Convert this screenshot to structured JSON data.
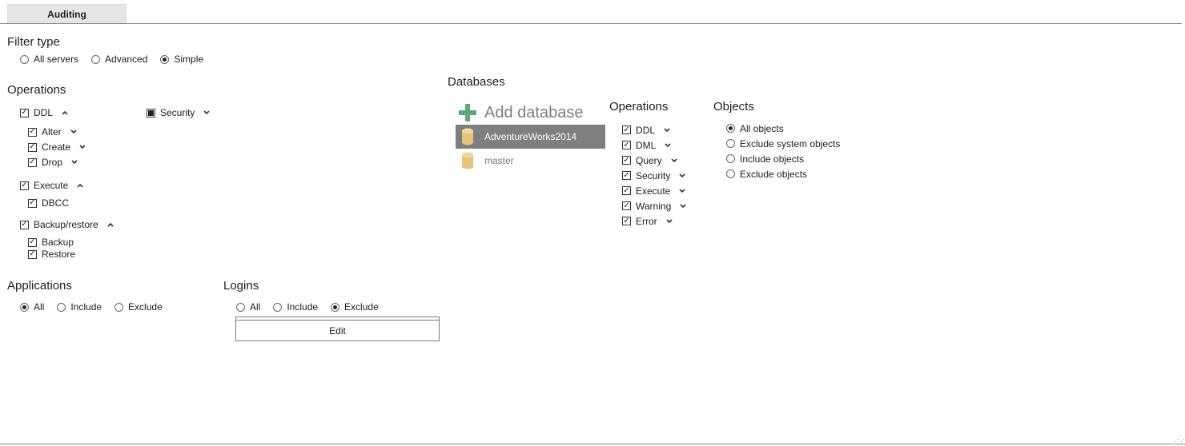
{
  "tab": {
    "label": "Auditing"
  },
  "filter_type": {
    "title": "Filter type",
    "options": [
      {
        "label": "All servers",
        "selected": false
      },
      {
        "label": "Advanced",
        "selected": false
      },
      {
        "label": "Simple",
        "selected": true
      }
    ]
  },
  "operations": {
    "title": "Operations",
    "ddl": {
      "label": "DDL",
      "checked": true,
      "children": [
        "Alter",
        "Create",
        "Drop"
      ]
    },
    "security": {
      "label": "Security",
      "state": "partial"
    },
    "execute": {
      "label": "Execute",
      "checked": true,
      "children": [
        "DBCC"
      ]
    },
    "backup_restore": {
      "label": "Backup/restore",
      "checked": true,
      "children": [
        "Backup",
        "Restore"
      ]
    }
  },
  "applications": {
    "title": "Applications",
    "options": [
      {
        "label": "All",
        "selected": true
      },
      {
        "label": "Include",
        "selected": false
      },
      {
        "label": "Exclude",
        "selected": false
      }
    ]
  },
  "logins": {
    "title": "Logins",
    "options": [
      {
        "label": "All",
        "selected": false
      },
      {
        "label": "Include",
        "selected": false
      },
      {
        "label": "Exclude",
        "selected": true
      }
    ],
    "edit_label": "Edit"
  },
  "databases": {
    "title": "Databases",
    "add_label": "Add database",
    "items": [
      {
        "name": "AdventureWorks2014",
        "selected": true
      },
      {
        "name": "master",
        "selected": false
      }
    ]
  },
  "db_operations": {
    "title": "Operations",
    "items": [
      "DDL",
      "DML",
      "Query",
      "Security",
      "Execute",
      "Warning",
      "Error"
    ]
  },
  "objects": {
    "title": "Objects",
    "options": [
      {
        "label": "All objects",
        "selected": true
      },
      {
        "label": "Exclude system objects",
        "selected": false
      },
      {
        "label": "Include objects",
        "selected": false
      },
      {
        "label": "Exclude objects",
        "selected": false
      }
    ]
  },
  "colors": {
    "accent_plus": "#5fa87e",
    "db_icon": "#e6c47e",
    "selected_bg": "#7f7f7f"
  }
}
